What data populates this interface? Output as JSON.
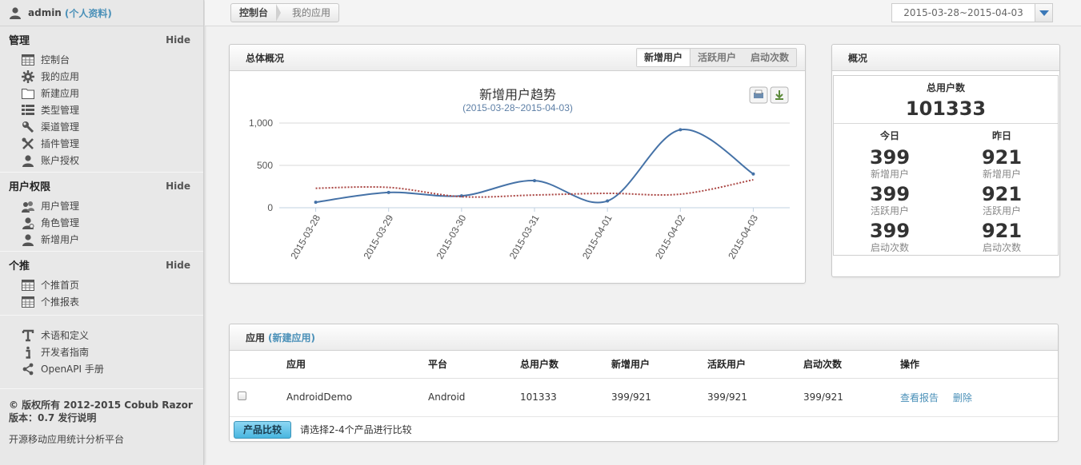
{
  "user": {
    "name": "admin",
    "profile_link": "(个人资料)"
  },
  "sidebar": {
    "sections": [
      {
        "title": "管理",
        "hide": "Hide",
        "items": [
          {
            "label": "控制台",
            "icon": "calendar-icon"
          },
          {
            "label": "我的应用",
            "icon": "gear-icon"
          },
          {
            "label": "新建应用",
            "icon": "folder-icon"
          },
          {
            "label": "类型管理",
            "icon": "list-icon"
          },
          {
            "label": "渠道管理",
            "icon": "wrench-icon"
          },
          {
            "label": "插件管理",
            "icon": "tools-icon"
          },
          {
            "label": "账户授权",
            "icon": "user-icon"
          }
        ]
      },
      {
        "title": "用户权限",
        "hide": "Hide",
        "items": [
          {
            "label": "用户管理",
            "icon": "users-icon"
          },
          {
            "label": "角色管理",
            "icon": "role-icon"
          },
          {
            "label": "新增用户",
            "icon": "user-icon"
          }
        ]
      },
      {
        "title": "个推",
        "hide": "Hide",
        "items": [
          {
            "label": "个推首页",
            "icon": "calendar-icon"
          },
          {
            "label": "个推报表",
            "icon": "calendar-icon"
          }
        ]
      }
    ],
    "extra_items": [
      {
        "label": "术语和定义",
        "icon": "text-icon"
      },
      {
        "label": "开发者指南",
        "icon": "info-icon"
      },
      {
        "label": "OpenAPI 手册",
        "icon": "share-icon"
      }
    ],
    "copyright": "© 版权所有 2012-2015 Cobub Razor 版本：0.7 发行说明",
    "tagline": "开源移动应用统计分析平台"
  },
  "breadcrumb": {
    "home": "控制台",
    "current": "我的应用"
  },
  "date_range": "2015-03-28~2015-04-03",
  "overview": {
    "title": "总体概况",
    "tabs": [
      "新增用户",
      "活跃用户",
      "启动次数"
    ],
    "active_tab": 0
  },
  "chart_data": {
    "type": "line",
    "title": "新增用户趋势",
    "subtitle": "(2015-03-28~2015-04-03)",
    "categories": [
      "2015-03-28",
      "2015-03-29",
      "2015-03-30",
      "2015-03-31",
      "2015-04-01",
      "2015-04-02",
      "2015-04-03"
    ],
    "y_ticks": [
      "0",
      "500",
      "1,000"
    ],
    "ylim": [
      0,
      1000
    ],
    "series": [
      {
        "values": [
          65,
          180,
          140,
          320,
          80,
          921,
          399
        ],
        "color": "#4572a7",
        "style": "solid"
      },
      {
        "values": [
          230,
          240,
          130,
          150,
          170,
          160,
          330
        ],
        "color": "#aa4643",
        "style": "dotted"
      }
    ]
  },
  "summary": {
    "title": "概况",
    "total_label": "总用户数",
    "total": "101333",
    "today_label": "今日",
    "yesterday_label": "昨日",
    "rows": [
      {
        "today": "399",
        "yesterday": "921",
        "label": "新增用户"
      },
      {
        "today": "399",
        "yesterday": "921",
        "label": "活跃用户"
      },
      {
        "today": "399",
        "yesterday": "921",
        "label": "启动次数"
      }
    ]
  },
  "apps": {
    "title": "应用",
    "new_link": "(新建应用)",
    "columns": [
      "应用",
      "平台",
      "总用户数",
      "新增用户",
      "活跃用户",
      "启动次数",
      "操作"
    ],
    "rows": [
      {
        "name": "AndroidDemo",
        "platform": "Android",
        "total": "101333",
        "new": "399/921",
        "active": "399/921",
        "launches": "399/921",
        "view": "查看报告",
        "delete": "删除"
      }
    ],
    "compare_button": "产品比较",
    "compare_hint": "请选择2-4个产品进行比较"
  }
}
